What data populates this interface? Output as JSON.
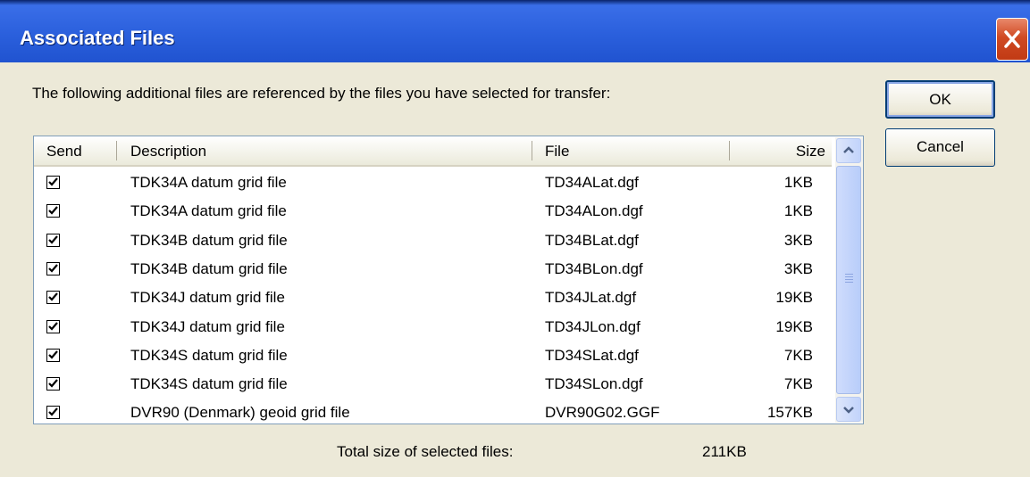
{
  "window": {
    "title": "Associated Files",
    "close_icon": "close-icon",
    "accent": "#2a5fdc",
    "close_color": "#d04a23"
  },
  "intro_text": "The following additional files are referenced by the files you have selected for transfer:",
  "buttons": {
    "ok_label": "OK",
    "cancel_label": "Cancel"
  },
  "table": {
    "columns": {
      "send": "Send",
      "description": "Description",
      "file": "File",
      "size": "Size"
    },
    "rows": [
      {
        "checked": true,
        "description": "TDK34A datum grid file",
        "file": "TD34ALat.dgf",
        "size": "1KB"
      },
      {
        "checked": true,
        "description": "TDK34A datum grid file",
        "file": "TD34ALon.dgf",
        "size": "1KB"
      },
      {
        "checked": true,
        "description": "TDK34B datum grid file",
        "file": "TD34BLat.dgf",
        "size": "3KB"
      },
      {
        "checked": true,
        "description": "TDK34B datum grid file",
        "file": "TD34BLon.dgf",
        "size": "3KB"
      },
      {
        "checked": true,
        "description": "TDK34J datum grid file",
        "file": "TD34JLat.dgf",
        "size": "19KB"
      },
      {
        "checked": true,
        "description": "TDK34J datum grid file",
        "file": "TD34JLon.dgf",
        "size": "19KB"
      },
      {
        "checked": true,
        "description": "TDK34S datum grid file",
        "file": "TD34SLat.dgf",
        "size": "7KB"
      },
      {
        "checked": true,
        "description": "TDK34S datum grid file",
        "file": "TD34SLon.dgf",
        "size": "7KB"
      },
      {
        "checked": true,
        "description": "DVR90 (Denmark) geoid grid file",
        "file": "DVR90G02.GGF",
        "size": "157KB"
      }
    ]
  },
  "scrollbar": {
    "up_icon": "chevron-up-icon",
    "down_icon": "chevron-down-icon",
    "grip_icon": "grip-icon"
  },
  "total": {
    "label": "Total size of selected files:",
    "value": "211KB"
  }
}
